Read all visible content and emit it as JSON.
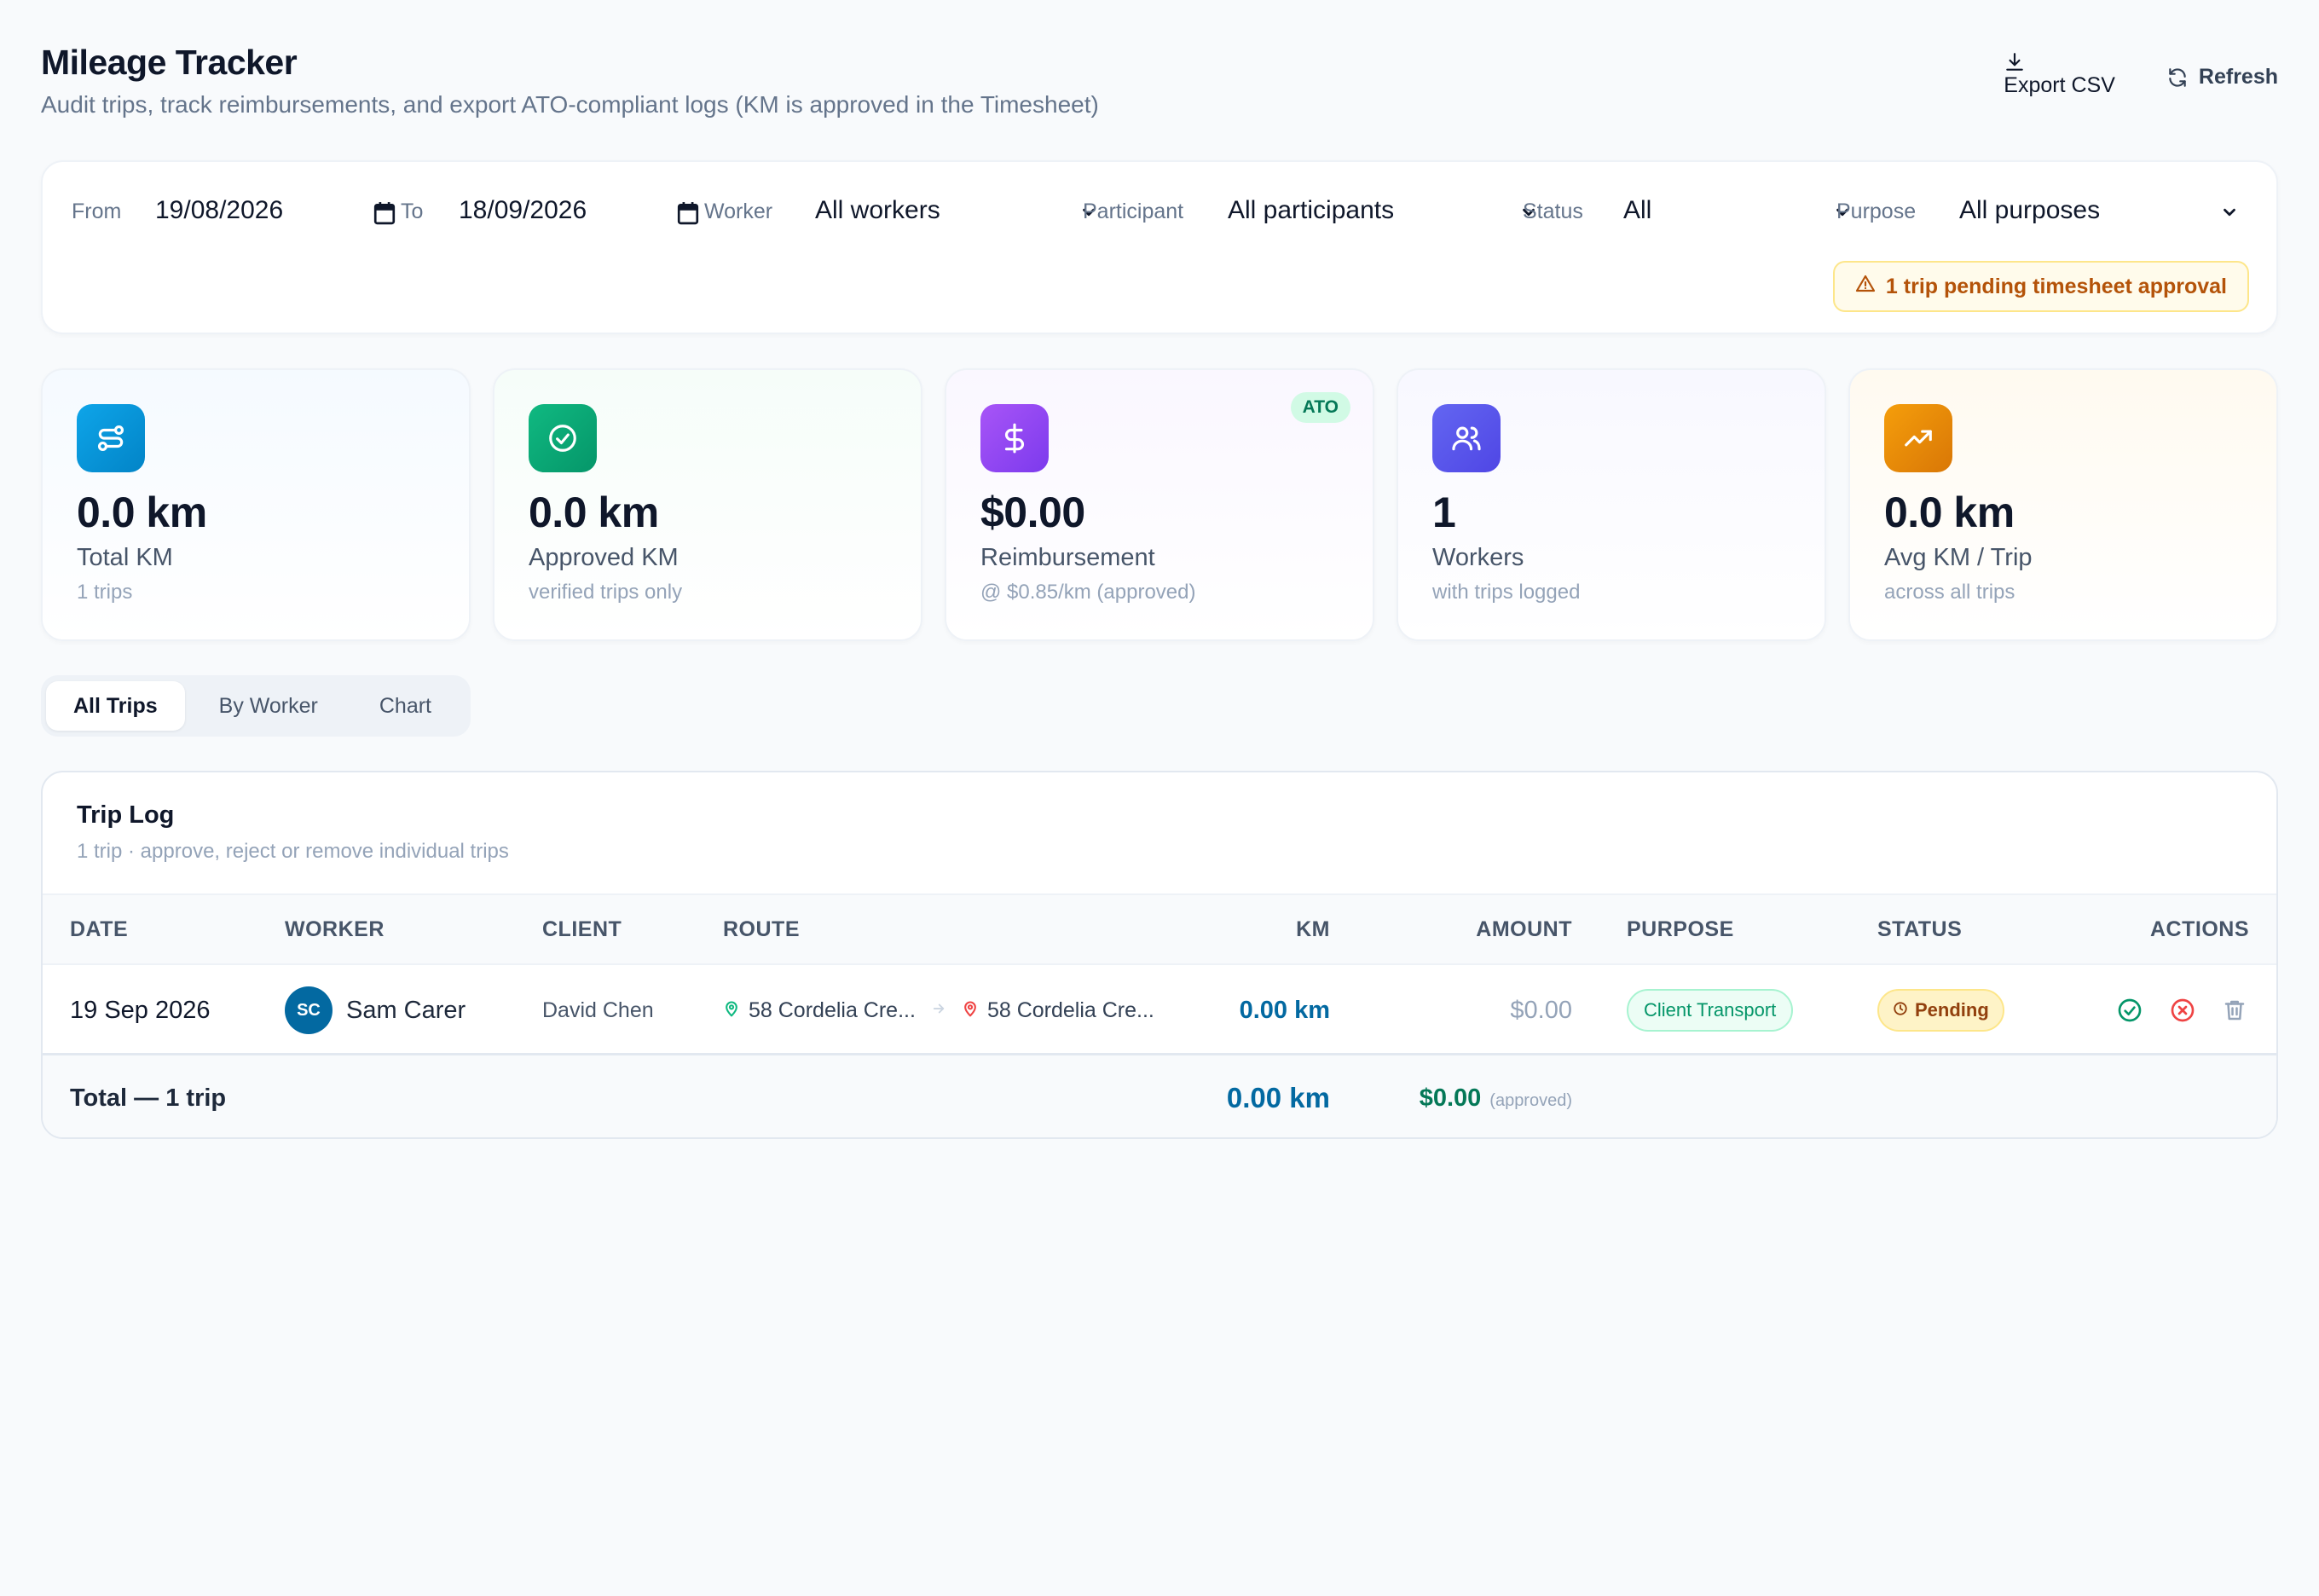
{
  "header": {
    "title": "Mileage Tracker",
    "subtitle": "Audit trips, track reimbursements, and export ATO-compliant logs (KM is approved in the Timesheet)",
    "export_label": "Export CSV",
    "refresh_label": "Refresh"
  },
  "filters": {
    "from_label": "From",
    "from_value": "19/08/2026",
    "to_label": "To",
    "to_value": "18/09/2026",
    "worker_label": "Worker",
    "worker_value": "All workers",
    "participant_label": "Participant",
    "participant_value": "All participants",
    "status_label": "Status",
    "status_value": "All",
    "purpose_label": "Purpose",
    "purpose_value": "All purposes",
    "pending_notice": "1 trip pending timesheet approval"
  },
  "stats": [
    {
      "value": "0.0 km",
      "label": "Total KM",
      "sub": "1 trips",
      "icon": "route-icon",
      "color": "#0ea5e9"
    },
    {
      "value": "0.0 km",
      "label": "Approved KM",
      "sub": "verified trips only",
      "icon": "check-circle-icon",
      "color": "#10b981"
    },
    {
      "value": "$0.00",
      "label": "Reimbursement",
      "sub": "@ $0.85/km (approved)",
      "icon": "dollar-icon",
      "color": "#8b5cf6",
      "badge": "ATO"
    },
    {
      "value": "1",
      "label": "Workers",
      "sub": "with trips logged",
      "icon": "users-icon",
      "color": "#6366f1"
    },
    {
      "value": "0.0 km",
      "label": "Avg KM / Trip",
      "sub": "across all trips",
      "icon": "trending-up-icon",
      "color": "#f59e0b"
    }
  ],
  "tabs": [
    "All Trips",
    "By Worker",
    "Chart"
  ],
  "trip_log": {
    "title": "Trip Log",
    "subtitle": "1 trip · approve, reject or remove individual trips",
    "columns": [
      "DATE",
      "WORKER",
      "CLIENT",
      "ROUTE",
      "KM",
      "AMOUNT",
      "PURPOSE",
      "STATUS",
      "ACTIONS"
    ],
    "rows": [
      {
        "date": "19 Sep 2026",
        "worker_initials": "SC",
        "worker": "Sam Carer",
        "client": "David Chen",
        "route_from": "58 Cordelia Cre...",
        "route_to": "58 Cordelia Cre...",
        "km": "0.00 km",
        "amount": "$0.00",
        "purpose": "Client Transport",
        "status": "Pending"
      }
    ],
    "footer": {
      "label": "Total — 1 trip",
      "km": "0.00 km",
      "amount": "$0.00",
      "amount_note": "(approved)"
    }
  }
}
